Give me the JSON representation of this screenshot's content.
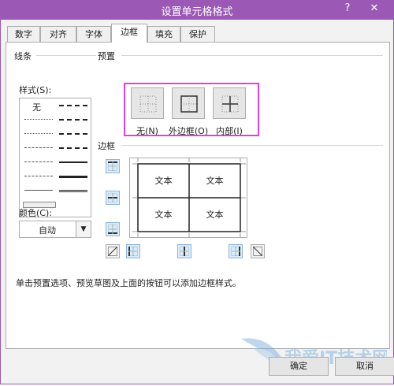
{
  "window": {
    "title": "设置单元格格式",
    "help_glyph": "?",
    "close_glyph": "✕"
  },
  "tabs": [
    {
      "label": "数字"
    },
    {
      "label": "对齐"
    },
    {
      "label": "字体"
    },
    {
      "label": "边框",
      "active": true
    },
    {
      "label": "填充"
    },
    {
      "label": "保护"
    }
  ],
  "line_section": {
    "title": "线条",
    "style_label": "样式(S):",
    "none_label": "无",
    "color_label": "颜色(C):",
    "color_value": "自动"
  },
  "presets": {
    "title": "预置",
    "items": [
      {
        "label": "无(N)"
      },
      {
        "label": "外边框(O)"
      },
      {
        "label": "内部(I)"
      }
    ]
  },
  "border_section": {
    "title": "边框",
    "cell_text": [
      "文本",
      "文本",
      "文本",
      "文本"
    ]
  },
  "help_text": "单击预置选项、预览草图及上面的按钮可以添加边框样式。",
  "buttons": {
    "ok": "确定",
    "cancel": "取消"
  },
  "colors": {
    "title_bar": "#9b58b5",
    "highlight": "#e040e0",
    "button_face": "#e6e6e6"
  }
}
